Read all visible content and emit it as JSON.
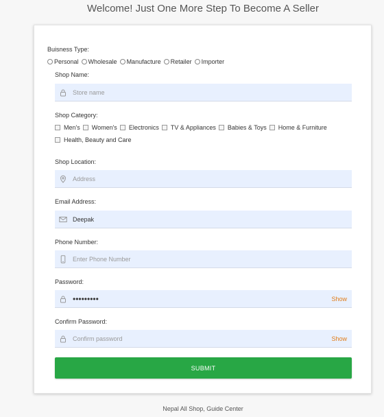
{
  "page": {
    "title": "Welcome! Just One More Step To Become A Seller",
    "footer": "Nepal All Shop, Guide Center"
  },
  "business_type": {
    "label": "Buisness Type:",
    "options": [
      "Personal",
      "Wholesale",
      "Manufacture",
      "Retailer",
      "Importer"
    ]
  },
  "shop_name": {
    "label": "Shop Name:",
    "placeholder": "Store name",
    "icon": "lock-icon"
  },
  "shop_category": {
    "label": "Shop Category:",
    "options_row1": [
      "Men's",
      "Women's",
      "Electronics",
      "TV & Appliances",
      "Babies & Toys",
      "Home & Furniture"
    ],
    "options_row2": [
      "Health, Beauty and Care"
    ]
  },
  "shop_location": {
    "label": "Shop Location:",
    "placeholder": "Address",
    "icon": "map-pin-icon"
  },
  "email": {
    "label": "Email Address:",
    "value": "Deepak",
    "icon": "envelope-icon"
  },
  "phone": {
    "label": "Phone Number:",
    "placeholder": "Enter Phone Number",
    "icon": "mobile-phone-icon"
  },
  "password": {
    "label": "Password:",
    "value": "•••••••••",
    "show": "Show",
    "icon": "lock-icon"
  },
  "confirm_password": {
    "label": "Confirm Password:",
    "placeholder": "Confirm password",
    "show": "Show",
    "icon": "lock-icon"
  },
  "submit": {
    "label": "SUBMIT",
    "color": "#28a745"
  },
  "colors": {
    "field_bg": "#e8f0fe",
    "show_link": "#e07b17"
  }
}
